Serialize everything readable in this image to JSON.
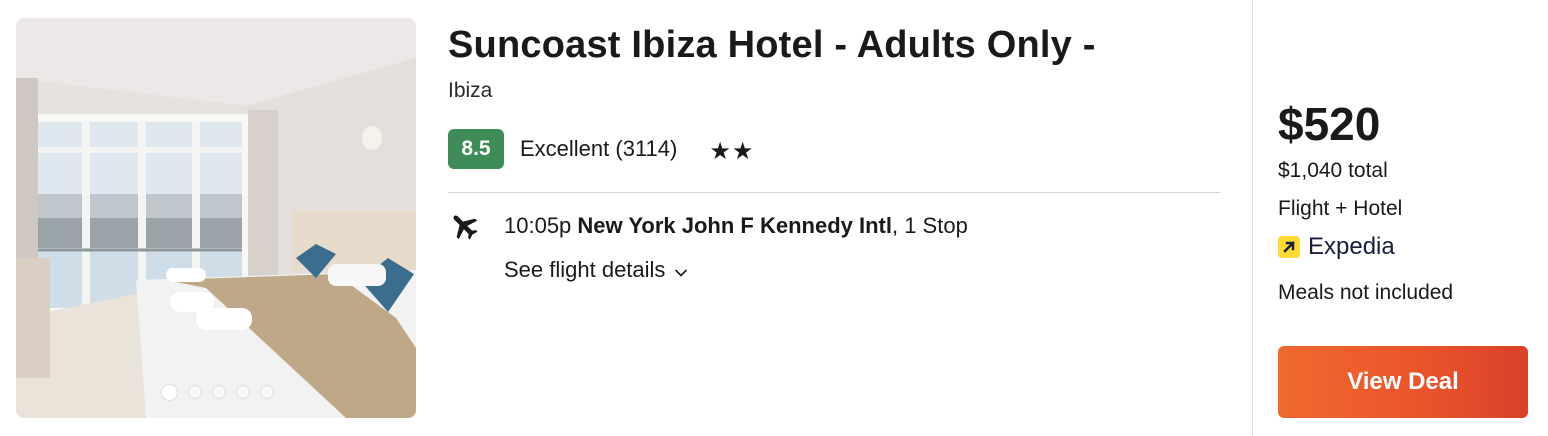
{
  "hotel": {
    "name": "Suncoast Ibiza Hotel - Adults Only -",
    "location": "Ibiza",
    "score": "8.5",
    "rating_text": "Excellent (3114)",
    "stars": "★★",
    "star_count": 2,
    "photo": {
      "slides": 5,
      "active_slide": 1
    }
  },
  "flight": {
    "icon": "airplane-icon",
    "time": "10:05p",
    "airport": "New York John F Kennedy Intl",
    "stops": ", 1 Stop",
    "details_label": "See flight details"
  },
  "deal": {
    "price": "$520",
    "total": "$1,040 total",
    "package": "Flight + Hotel",
    "provider": "Expedia",
    "meals": "Meals not included",
    "button_label": "View Deal"
  },
  "colors": {
    "score_badge": "#3e8c57",
    "button": "#e9532a",
    "provider_logo": "#fddb32"
  }
}
